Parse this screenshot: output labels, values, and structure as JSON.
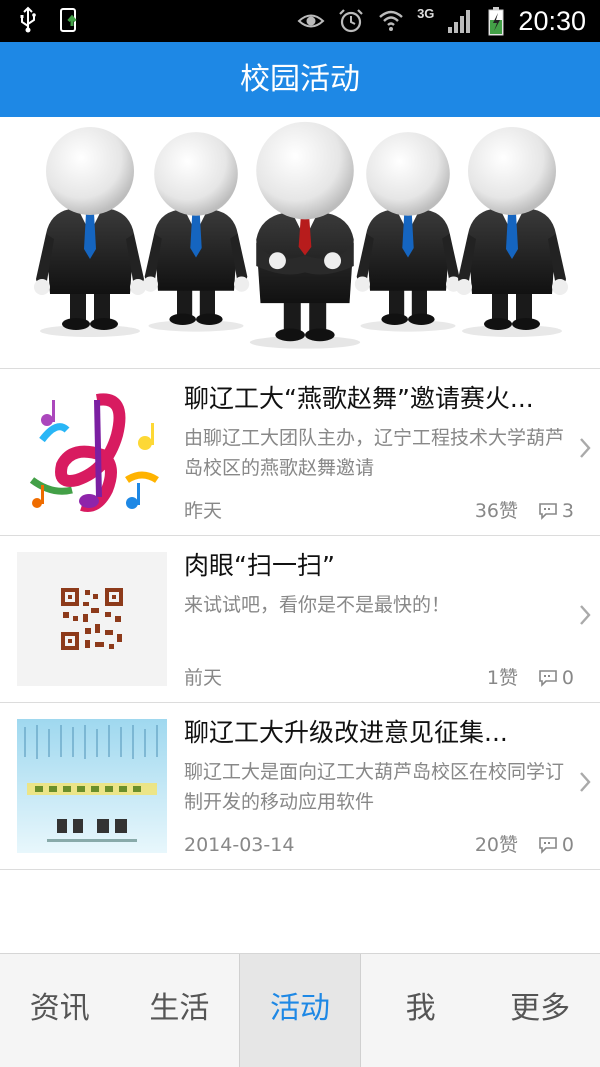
{
  "status_bar": {
    "time": "20:30",
    "network": "3G",
    "icons": [
      "usb-icon",
      "phone-update-icon",
      "eye-icon",
      "alarm-icon",
      "wifi-icon",
      "signal-icon",
      "battery-charging-icon"
    ]
  },
  "header": {
    "title": "校园活动"
  },
  "banner": {
    "image": "business-people-figures"
  },
  "items": [
    {
      "title": "聊辽工大“燕歌赵舞”邀请赛火...",
      "desc": "由聊辽工大团队主办，辽宁工程技术大学葫芦岛校区的燕歌赵舞邀请",
      "date": "昨天",
      "likes": "36赞",
      "comments": "3",
      "thumb": "music-notes"
    },
    {
      "title": "肉眼“扫一扫”",
      "desc": "来试试吧，看你是不是最快的！",
      "date": "前天",
      "likes": "1赞",
      "comments": "0",
      "thumb": "qr-code"
    },
    {
      "title": "聊辽工大升级改进意见征集...",
      "desc": "聊辽工大是面向辽工大葫芦岛校区在校同学订制开发的移动应用软件",
      "date": "2014-03-14",
      "likes": "20赞",
      "comments": "0",
      "thumb": "calligraphy-poster"
    }
  ],
  "bottom_nav": {
    "tabs": [
      {
        "label": "资讯"
      },
      {
        "label": "生活"
      },
      {
        "label": "活动"
      },
      {
        "label": "我"
      },
      {
        "label": "更多"
      }
    ],
    "active_index": 2
  },
  "colors": {
    "accent": "#1e88e5",
    "statusbar": "#000000",
    "muted_text": "#888888"
  }
}
